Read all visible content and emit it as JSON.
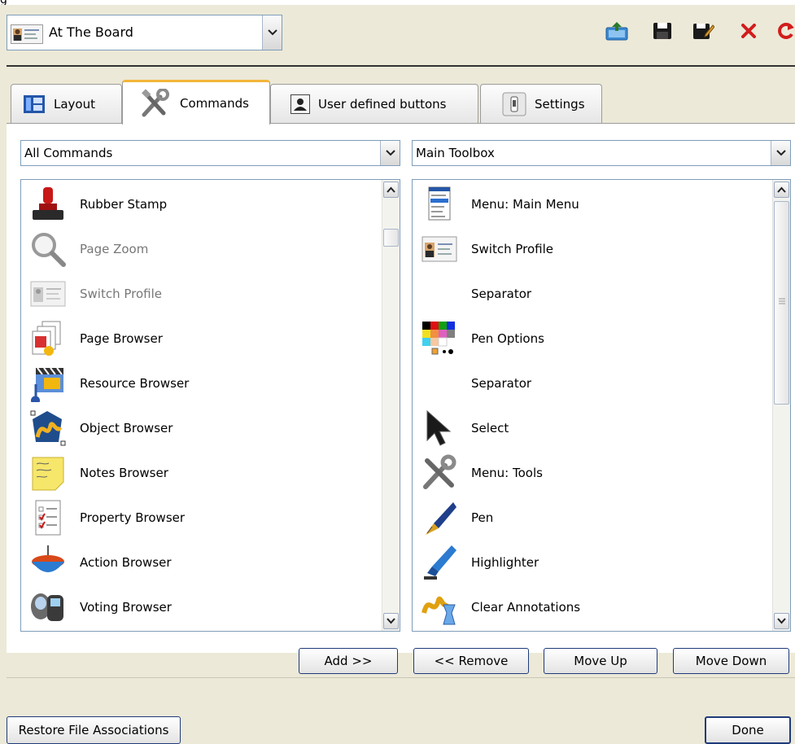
{
  "header": {
    "profile_value": "At The Board",
    "toolbar_icons": [
      "export-icon",
      "save-icon",
      "edit-save-icon",
      "delete-icon",
      "refresh-icon"
    ]
  },
  "tabs": [
    {
      "label": "Layout",
      "icon": "layout-icon"
    },
    {
      "label": "Commands",
      "icon": "tools-icon",
      "active": true
    },
    {
      "label": "User defined buttons",
      "icon": "user-icon"
    },
    {
      "label": "Settings",
      "icon": "settings-icon"
    }
  ],
  "left": {
    "filter_value": "All Commands",
    "items": [
      {
        "label": "Rubber Stamp",
        "icon": "rubber-stamp-icon",
        "enabled": true
      },
      {
        "label": "Page Zoom",
        "icon": "magnifier-icon",
        "enabled": false
      },
      {
        "label": "Switch Profile",
        "icon": "id-card-icon",
        "enabled": false
      },
      {
        "label": "Page Browser",
        "icon": "page-browser-icon",
        "enabled": true
      },
      {
        "label": "Resource Browser",
        "icon": "resource-browser-icon",
        "enabled": true
      },
      {
        "label": "Object Browser",
        "icon": "object-browser-icon",
        "enabled": true
      },
      {
        "label": "Notes Browser",
        "icon": "sticky-note-icon",
        "enabled": true
      },
      {
        "label": "Property Browser",
        "icon": "property-sheet-icon",
        "enabled": true
      },
      {
        "label": "Action Browser",
        "icon": "spinning-top-icon",
        "enabled": true
      },
      {
        "label": "Voting Browser",
        "icon": "voting-device-icon",
        "enabled": true
      }
    ]
  },
  "right": {
    "toolbox_value": "Main Toolbox",
    "items": [
      {
        "label": "Menu: Main Menu",
        "icon": "menu-icon"
      },
      {
        "label": "Switch Profile",
        "icon": "id-card-icon"
      },
      {
        "label": "Separator",
        "icon": ""
      },
      {
        "label": "Pen Options",
        "icon": "color-palette-icon"
      },
      {
        "label": "Separator",
        "icon": ""
      },
      {
        "label": "Select",
        "icon": "cursor-arrow-icon"
      },
      {
        "label": "Menu: Tools",
        "icon": "tools-icon"
      },
      {
        "label": "Pen",
        "icon": "fountain-pen-icon"
      },
      {
        "label": "Highlighter",
        "icon": "highlighter-icon"
      },
      {
        "label": "Clear Annotations",
        "icon": "clear-annotations-icon"
      }
    ]
  },
  "buttons": {
    "add": "Add >>",
    "remove": "<< Remove",
    "move_up": "Move Up",
    "move_down": "Move Down",
    "restore": "Restore File Associations",
    "done": "Done"
  }
}
